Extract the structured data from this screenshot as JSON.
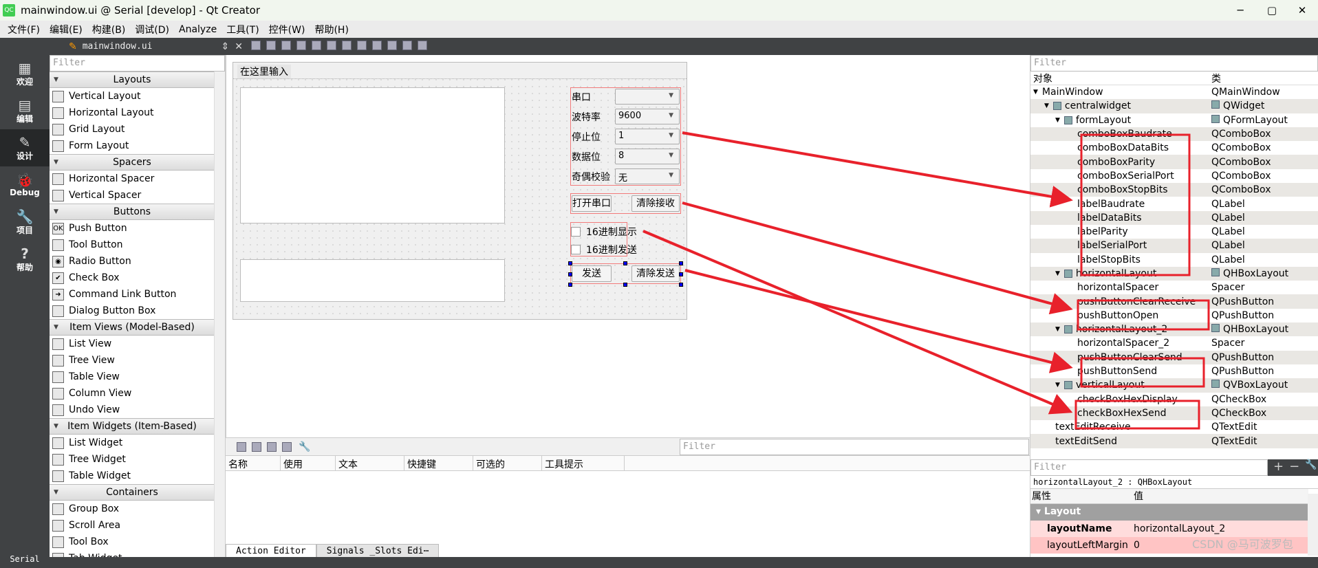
{
  "window": {
    "title": "mainwindow.ui @ Serial [develop] - Qt Creator",
    "logo": "QC",
    "minimize": "─",
    "maximize": "▢",
    "close": "✕"
  },
  "menu": [
    "文件(F)",
    "编辑(E)",
    "构建(B)",
    "调试(D)",
    "Analyze",
    "工具(T)",
    "控件(W)",
    "帮助(H)"
  ],
  "toolbar": {
    "file": "mainwindow.ui",
    "close": "✕"
  },
  "modes": [
    {
      "label": "欢迎",
      "icon": "▦"
    },
    {
      "label": "编辑",
      "icon": "▤"
    },
    {
      "label": "设计",
      "icon": "✎",
      "active": true
    },
    {
      "label": "Debug",
      "icon": "🐞"
    },
    {
      "label": "项目",
      "icon": "🔧"
    },
    {
      "label": "帮助",
      "icon": "?"
    }
  ],
  "project_label": "Serial",
  "widgetbox": {
    "filter_placeholder": "Filter",
    "sections": [
      {
        "title": "Layouts",
        "items": [
          "Vertical Layout",
          "Horizontal Layout",
          "Grid Layout",
          "Form Layout"
        ]
      },
      {
        "title": "Spacers",
        "items": [
          "Horizontal Spacer",
          "Vertical Spacer"
        ]
      },
      {
        "title": "Buttons",
        "items": [
          "Push Button",
          "Tool Button",
          "Radio Button",
          "Check Box",
          "Command Link Button",
          "Dialog Button Box"
        ]
      },
      {
        "title": "Item Views (Model-Based)",
        "items": [
          "List View",
          "Tree View",
          "Table View",
          "Column View",
          "Undo View"
        ]
      },
      {
        "title": "Item Widgets (Item-Based)",
        "items": [
          "List Widget",
          "Tree Widget",
          "Table Widget"
        ]
      },
      {
        "title": "Containers",
        "items": [
          "Group Box",
          "Scroll Area",
          "Tool Box",
          "Tab Widget"
        ]
      }
    ]
  },
  "form": {
    "menu_placeholder": "在这里输入",
    "labels": [
      "串口",
      "波特率",
      "停止位",
      "数据位",
      "奇偶校验"
    ],
    "combos": [
      "",
      "9600",
      "1",
      "8",
      "无"
    ],
    "buttons": {
      "open": "打开串口",
      "clear_receive": "清除接收",
      "send": "发送",
      "clear_send": "清除发送"
    },
    "checkboxes": [
      {
        "label": "16进制显示",
        "checked": false
      },
      {
        "label": "16进制发送",
        "checked": false
      }
    ]
  },
  "action_editor": {
    "filter_placeholder": "Filter",
    "columns": [
      "名称",
      "使用",
      "文本",
      "快捷键",
      "可选的",
      "工具提示"
    ],
    "tabs": [
      "Action Editor",
      "Signals _Slots Edi⋯"
    ]
  },
  "object_inspector": {
    "filter_placeholder": "Filter",
    "columns": [
      "对象",
      "类"
    ],
    "rows": [
      {
        "name": "MainWindow",
        "cls": "QMainWindow",
        "level": 0
      },
      {
        "name": "centralwidget",
        "cls": "QWidget",
        "level": 1
      },
      {
        "name": "formLayout",
        "cls": "QFormLayout",
        "level": 2
      },
      {
        "name": "comboBoxBaudrate",
        "cls": "QComboBox",
        "level": 3
      },
      {
        "name": "comboBoxDataBits",
        "cls": "QComboBox",
        "level": 3
      },
      {
        "name": "comboBoxParity",
        "cls": "QComboBox",
        "level": 3
      },
      {
        "name": "comboBoxSerialPort",
        "cls": "QComboBox",
        "level": 3
      },
      {
        "name": "comboBoxStopBits",
        "cls": "QComboBox",
        "level": 3
      },
      {
        "name": "labelBaudrate",
        "cls": "QLabel",
        "level": 3
      },
      {
        "name": "labelDataBits",
        "cls": "QLabel",
        "level": 3
      },
      {
        "name": "labelParity",
        "cls": "QLabel",
        "level": 3
      },
      {
        "name": "labelSerialPort",
        "cls": "QLabel",
        "level": 3
      },
      {
        "name": "labelStopBits",
        "cls": "QLabel",
        "level": 3
      },
      {
        "name": "horizontalLayout",
        "cls": "QHBoxLayout",
        "level": 2
      },
      {
        "name": "horizontalSpacer",
        "cls": "Spacer",
        "level": 3
      },
      {
        "name": "pushButtonClearReceive",
        "cls": "QPushButton",
        "level": 3
      },
      {
        "name": "pushButtonOpen",
        "cls": "QPushButton",
        "level": 3
      },
      {
        "name": "horizontalLayout_2",
        "cls": "QHBoxLayout",
        "level": 2
      },
      {
        "name": "horizontalSpacer_2",
        "cls": "Spacer",
        "level": 3
      },
      {
        "name": "pushButtonClearSend",
        "cls": "QPushButton",
        "level": 3
      },
      {
        "name": "pushButtonSend",
        "cls": "QPushButton",
        "level": 3
      },
      {
        "name": "verticalLayout",
        "cls": "QVBoxLayout",
        "level": 2
      },
      {
        "name": "checkBoxHexDisplay",
        "cls": "QCheckBox",
        "level": 3
      },
      {
        "name": "checkBoxHexSend",
        "cls": "QCheckBox",
        "level": 3
      },
      {
        "name": "textEditReceive",
        "cls": "QTextEdit",
        "level": 2
      },
      {
        "name": "textEditSend",
        "cls": "QTextEdit",
        "level": 2
      }
    ]
  },
  "property_editor": {
    "filter_placeholder": "Filter",
    "selected": "horizontalLayout_2 : QHBoxLayout",
    "columns": [
      "属性",
      "值"
    ],
    "group": "Layout",
    "rows": [
      {
        "name": "layoutName",
        "value": "horizontalLayout_2"
      },
      {
        "name": "layoutLeftMargin",
        "value": "0"
      }
    ]
  },
  "watermark": "CSDN @马可波罗包",
  "colors": {
    "annotation": "#e8212b",
    "dark_panel": "#404244",
    "selection_handle": "#0000ff"
  }
}
